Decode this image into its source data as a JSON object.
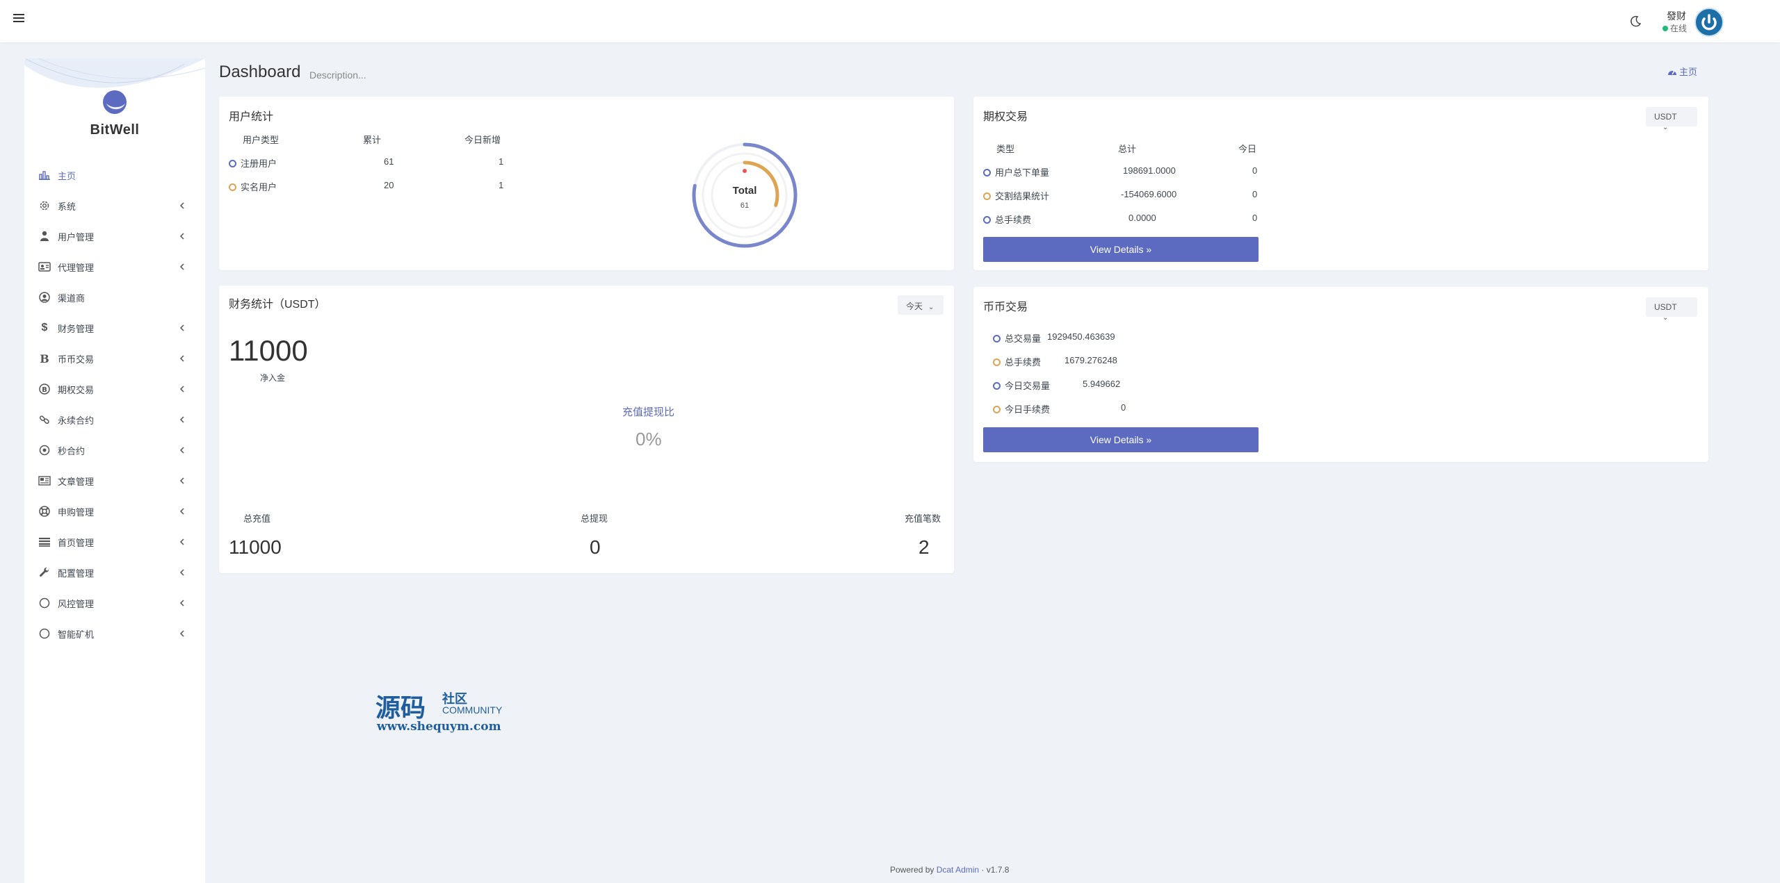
{
  "header": {
    "user_name": "發财",
    "user_status": "在线"
  },
  "sidebar": {
    "brand": "BitWell",
    "items": [
      {
        "label": "主页",
        "icon": "bar-chart-icon",
        "active": true,
        "caret": false
      },
      {
        "label": "系统",
        "icon": "gear-icon",
        "active": false,
        "caret": true
      },
      {
        "label": "用户管理",
        "icon": "user-icon",
        "active": false,
        "caret": true
      },
      {
        "label": "代理管理",
        "icon": "id-card-icon",
        "active": false,
        "caret": true
      },
      {
        "label": "渠道商",
        "icon": "user-circle-icon",
        "active": false,
        "caret": false
      },
      {
        "label": "财务管理",
        "icon": "dollar-icon",
        "active": false,
        "caret": true
      },
      {
        "label": "币币交易",
        "icon": "bitcoin-b-icon",
        "active": false,
        "caret": true
      },
      {
        "label": "期权交易",
        "icon": "bitcoin-circle-icon",
        "active": false,
        "caret": true
      },
      {
        "label": "永续合约",
        "icon": "link-icon",
        "active": false,
        "caret": true
      },
      {
        "label": "秒合约",
        "icon": "dot-circle-icon",
        "active": false,
        "caret": true
      },
      {
        "label": "文章管理",
        "icon": "newspaper-icon",
        "active": false,
        "caret": true
      },
      {
        "label": "申购管理",
        "icon": "lifebuoy-icon",
        "active": false,
        "caret": true
      },
      {
        "label": "首页管理",
        "icon": "list-icon",
        "active": false,
        "caret": true
      },
      {
        "label": "配置管理",
        "icon": "wrench-icon",
        "active": false,
        "caret": true
      },
      {
        "label": "风控管理",
        "icon": "circle-icon",
        "active": false,
        "caret": true
      },
      {
        "label": "智能矿机",
        "icon": "circle-icon",
        "active": false,
        "caret": true
      }
    ]
  },
  "page": {
    "title": "Dashboard",
    "description": "Description...",
    "breadcrumb": "主页"
  },
  "user_stats": {
    "title": "用户统计",
    "headers": [
      "用户类型",
      "累计",
      "今日新增"
    ],
    "rows": [
      {
        "type": "注册用户",
        "total": "61",
        "today": "1",
        "color": "#5c6bc0"
      },
      {
        "type": "实名用户",
        "total": "20",
        "today": "1",
        "color": "#dda451"
      }
    ],
    "donut": {
      "label": "Total",
      "value": "61",
      "outer_fraction": 0.78,
      "inner_fraction": 0.3
    }
  },
  "options_trading": {
    "title": "期权交易",
    "currency": "USDT",
    "headers": [
      "类型",
      "总计",
      "今日"
    ],
    "rows": [
      {
        "type": "用户总下单量",
        "total": "198691.0000",
        "today": "0",
        "color": "#5c6bc0"
      },
      {
        "type": "交割结果统计",
        "total": "-154069.6000",
        "today": "0",
        "color": "#dda451"
      },
      {
        "type": "总手续费",
        "total": "0.0000",
        "today": "0",
        "color": "#5c6bc0"
      }
    ],
    "button": "View Details »"
  },
  "finance": {
    "title": "财务统计（USDT）",
    "period": "今天",
    "net_value": "11000",
    "net_label": "净入金",
    "ratio_label": "充值提现比",
    "ratio_value": "0%",
    "stats": [
      {
        "label": "总充值",
        "value": "11000"
      },
      {
        "label": "总提现",
        "value": "0"
      },
      {
        "label": "充值笔数",
        "value": "2"
      }
    ]
  },
  "coin_trading": {
    "title": "币币交易",
    "currency": "USDT",
    "rows": [
      {
        "label": "总交易量",
        "value": "1929450.463639",
        "color": "#5c6bc0"
      },
      {
        "label": "总手续费",
        "value": "1679.276248",
        "color": "#dda451"
      },
      {
        "label": "今日交易量",
        "value": "5.949662",
        "color": "#5c6bc0"
      },
      {
        "label": "今日手续费",
        "value": "0",
        "color": "#dda451"
      }
    ],
    "button": "View Details »"
  },
  "footer": {
    "prefix": "Powered by",
    "link": "Dcat Admin",
    "version": "· v1.7.8"
  },
  "watermark": {
    "title": "源码",
    "subtitle": "社区",
    "community": "COMMUNITY",
    "url": "www.shequym.com"
  }
}
